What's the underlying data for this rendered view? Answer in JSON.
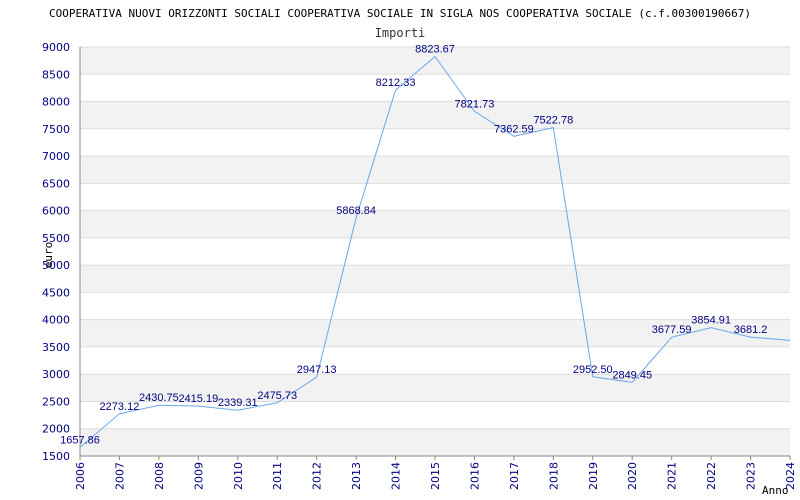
{
  "chart_data": {
    "type": "line",
    "title": "COOPERATIVA NUOVI ORIZZONTI SOCIALI COOPERATIVA SOCIALE IN SIGLA NOS COOPERATIVA SOCIALE (c.f.00300190667)",
    "subtitle": "Importi",
    "xlabel": "Anno",
    "ylabel": "euro",
    "x": [
      "2006",
      "2007",
      "2008",
      "2009",
      "2010",
      "2011",
      "2012",
      "2013",
      "2014",
      "2015",
      "2016",
      "2017",
      "2018",
      "2019",
      "2020",
      "2021",
      "2022",
      "2023",
      "2024"
    ],
    "series": [
      {
        "values": [
          1657.86,
          2273.12,
          2430.75,
          2415.19,
          2339.31,
          2475.73,
          2947.13,
          5868.84,
          8212.33,
          8823.67,
          7821.73,
          7362.59,
          7522.78,
          2952.5,
          2849.45,
          3677.59,
          3854.91,
          3681.2,
          null
        ],
        "labels": [
          "1657.86",
          "2273.12",
          "2430.75",
          "2415.19",
          "2339.31",
          "2475.73",
          "2947.13",
          "5868.84",
          "8212.33",
          "8823.67",
          "7821.73",
          "7362.59",
          "7522.78",
          "2952.50",
          "2849.45",
          "3677.59",
          "3854.91",
          "3681.2"
        ]
      }
    ],
    "ylim": [
      1500,
      9000
    ],
    "yticks": [
      1500,
      2000,
      2500,
      3000,
      3500,
      4000,
      4500,
      5000,
      5500,
      6000,
      6500,
      7000,
      7500,
      8000,
      8500,
      9000
    ],
    "grid": true,
    "colors": {
      "line": "#6aa8e8",
      "band": "#f2f2f2",
      "grid": "#dddddd",
      "tick_text": "#000080",
      "axis": "#888888"
    }
  }
}
